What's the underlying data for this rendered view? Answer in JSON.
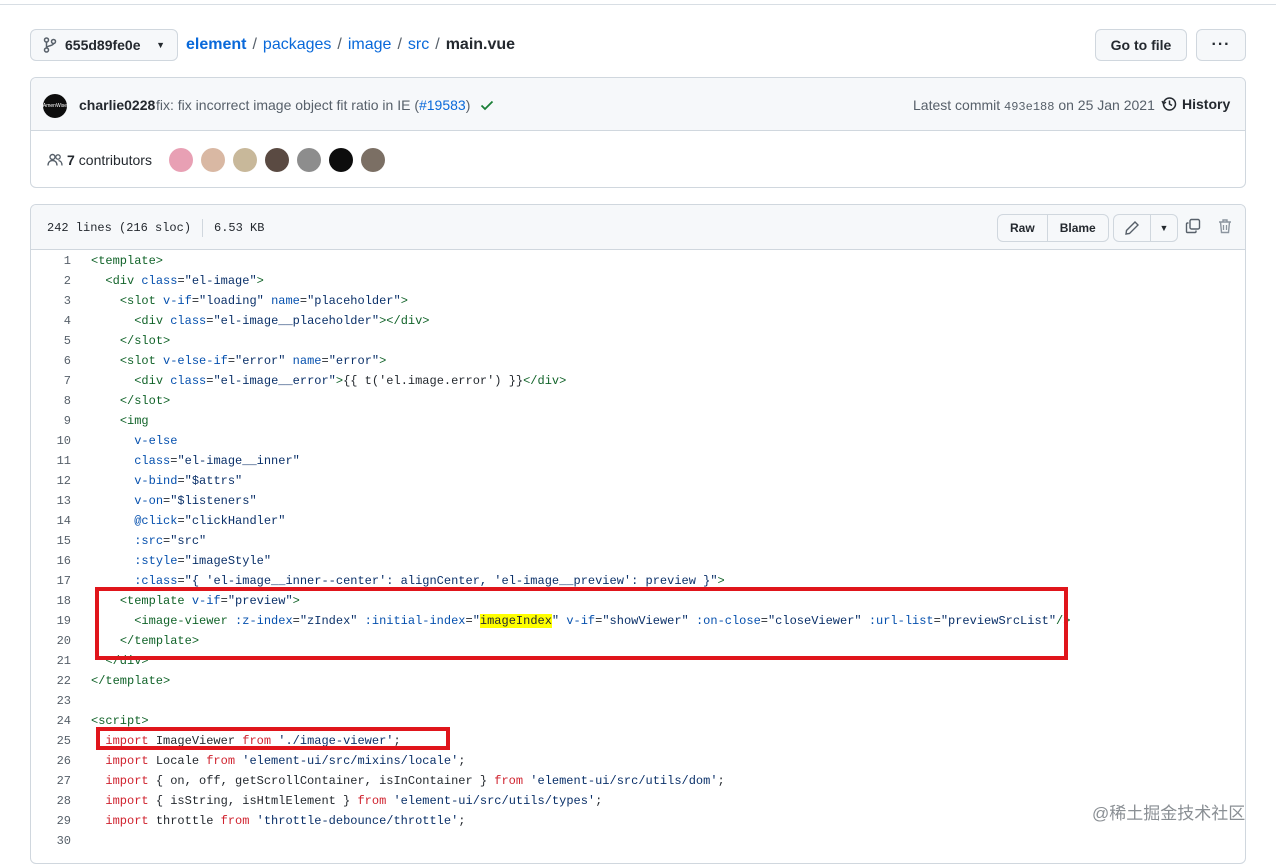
{
  "repo": {
    "branch": "655d89fe0e",
    "crumbs": [
      "element",
      "packages",
      "image",
      "src"
    ],
    "current_file": "main.vue",
    "goto_label": "Go to file",
    "more_label": "···"
  },
  "commit": {
    "author": "charlie0228",
    "avatar_text": "AmenWise",
    "message": "fix: fix incorrect image object fit ratio in IE (",
    "pr": "#19583",
    "message_tail": ")",
    "latest_label": "Latest commit",
    "sha": "493e188",
    "date": "on 25 Jan 2021",
    "history_label": "History",
    "contributors_count": "7",
    "contributors_label": "contributors",
    "contributor_colors": [
      "#e8a0b4",
      "#d9b8a3",
      "#c8b89a",
      "#5a4a42",
      "#8d8d8d",
      "#0d0d0d",
      "#7b6f64"
    ]
  },
  "file": {
    "lines_info": "242 lines (216 sloc)",
    "size": "6.53 KB",
    "raw_label": "Raw",
    "blame_label": "Blame"
  },
  "code_lines": [
    {
      "n": "1",
      "parts": [
        [
          "t",
          "<template>"
        ]
      ]
    },
    {
      "n": "2",
      "parts": [
        [
          "",
          "  "
        ],
        [
          "t",
          "<div"
        ],
        [
          "",
          " "
        ],
        [
          "a",
          "class"
        ],
        [
          "",
          "="
        ],
        [
          "s",
          "\"el-image\""
        ],
        [
          "t",
          ">"
        ]
      ]
    },
    {
      "n": "3",
      "parts": [
        [
          "",
          "    "
        ],
        [
          "t",
          "<slot"
        ],
        [
          "",
          " "
        ],
        [
          "a",
          "v-if"
        ],
        [
          "",
          "="
        ],
        [
          "s",
          "\"loading\""
        ],
        [
          "",
          " "
        ],
        [
          "a",
          "name"
        ],
        [
          "",
          "="
        ],
        [
          "s",
          "\"placeholder\""
        ],
        [
          "t",
          ">"
        ]
      ]
    },
    {
      "n": "4",
      "parts": [
        [
          "",
          "      "
        ],
        [
          "t",
          "<div"
        ],
        [
          "",
          " "
        ],
        [
          "a",
          "class"
        ],
        [
          "",
          "="
        ],
        [
          "s",
          "\"el-image__placeholder\""
        ],
        [
          "t",
          "></div>"
        ]
      ]
    },
    {
      "n": "5",
      "parts": [
        [
          "",
          "    "
        ],
        [
          "t",
          "</slot>"
        ]
      ]
    },
    {
      "n": "6",
      "parts": [
        [
          "",
          "    "
        ],
        [
          "t",
          "<slot"
        ],
        [
          "",
          " "
        ],
        [
          "a",
          "v-else-if"
        ],
        [
          "",
          "="
        ],
        [
          "s",
          "\"error\""
        ],
        [
          "",
          " "
        ],
        [
          "a",
          "name"
        ],
        [
          "",
          "="
        ],
        [
          "s",
          "\"error\""
        ],
        [
          "t",
          ">"
        ]
      ]
    },
    {
      "n": "7",
      "parts": [
        [
          "",
          "      "
        ],
        [
          "t",
          "<div"
        ],
        [
          "",
          " "
        ],
        [
          "a",
          "class"
        ],
        [
          "",
          "="
        ],
        [
          "s",
          "\"el-image__error\""
        ],
        [
          "t",
          ">"
        ],
        [
          "",
          "{{ t('el.image.error') }}"
        ],
        [
          "t",
          "</div>"
        ]
      ]
    },
    {
      "n": "8",
      "parts": [
        [
          "",
          "    "
        ],
        [
          "t",
          "</slot>"
        ]
      ]
    },
    {
      "n": "9",
      "parts": [
        [
          "",
          "    "
        ],
        [
          "t",
          "<img"
        ]
      ]
    },
    {
      "n": "10",
      "parts": [
        [
          "",
          "      "
        ],
        [
          "a",
          "v-else"
        ]
      ]
    },
    {
      "n": "11",
      "parts": [
        [
          "",
          "      "
        ],
        [
          "a",
          "class"
        ],
        [
          "",
          "="
        ],
        [
          "s",
          "\"el-image__inner\""
        ]
      ]
    },
    {
      "n": "12",
      "parts": [
        [
          "",
          "      "
        ],
        [
          "a",
          "v-bind"
        ],
        [
          "",
          "="
        ],
        [
          "s",
          "\"$attrs\""
        ]
      ]
    },
    {
      "n": "13",
      "parts": [
        [
          "",
          "      "
        ],
        [
          "a",
          "v-on"
        ],
        [
          "",
          "="
        ],
        [
          "s",
          "\"$listeners\""
        ]
      ]
    },
    {
      "n": "14",
      "parts": [
        [
          "",
          "      "
        ],
        [
          "a",
          "@click"
        ],
        [
          "",
          "="
        ],
        [
          "s",
          "\"clickHandler\""
        ]
      ]
    },
    {
      "n": "15",
      "parts": [
        [
          "",
          "      "
        ],
        [
          "a",
          ":src"
        ],
        [
          "",
          "="
        ],
        [
          "s",
          "\"src\""
        ]
      ]
    },
    {
      "n": "16",
      "parts": [
        [
          "",
          "      "
        ],
        [
          "a",
          ":style"
        ],
        [
          "",
          "="
        ],
        [
          "s",
          "\"imageStyle\""
        ]
      ]
    },
    {
      "n": "17",
      "parts": [
        [
          "",
          "      "
        ],
        [
          "a",
          ":class"
        ],
        [
          "",
          "="
        ],
        [
          "s",
          "\"{ 'el-image__inner--center': alignCenter, 'el-image__preview': preview }\""
        ],
        [
          "t",
          ">"
        ]
      ]
    },
    {
      "n": "18",
      "parts": [
        [
          "",
          "    "
        ],
        [
          "t",
          "<template"
        ],
        [
          "",
          " "
        ],
        [
          "a",
          "v-if"
        ],
        [
          "",
          "="
        ],
        [
          "s",
          "\"preview\""
        ],
        [
          "t",
          ">"
        ]
      ]
    },
    {
      "n": "19",
      "parts": [
        [
          "",
          "      "
        ],
        [
          "t",
          "<image-viewer"
        ],
        [
          "",
          " "
        ],
        [
          "a",
          ":z-index"
        ],
        [
          "",
          "="
        ],
        [
          "s",
          "\"zIndex\""
        ],
        [
          "",
          " "
        ],
        [
          "a",
          ":initial-index"
        ],
        [
          "",
          "="
        ],
        [
          "s",
          "\""
        ],
        [
          "m",
          "imageIndex"
        ],
        [
          "s",
          "\""
        ],
        [
          "",
          " "
        ],
        [
          "a",
          "v-if"
        ],
        [
          "",
          "="
        ],
        [
          "s",
          "\"showViewer\""
        ],
        [
          "",
          " "
        ],
        [
          "a",
          ":on-close"
        ],
        [
          "",
          "="
        ],
        [
          "s",
          "\"closeViewer\""
        ],
        [
          "",
          " "
        ],
        [
          "a",
          ":url-list"
        ],
        [
          "",
          "="
        ],
        [
          "s",
          "\"previewSrcList\""
        ],
        [
          "t",
          "/>"
        ]
      ]
    },
    {
      "n": "20",
      "parts": [
        [
          "",
          "    "
        ],
        [
          "t",
          "</template>"
        ]
      ]
    },
    {
      "n": "21",
      "parts": [
        [
          "",
          "  "
        ],
        [
          "t",
          "</div>"
        ]
      ]
    },
    {
      "n": "22",
      "parts": [
        [
          "t",
          "</template>"
        ]
      ]
    },
    {
      "n": "23",
      "parts": [
        [
          "",
          ""
        ]
      ]
    },
    {
      "n": "24",
      "parts": [
        [
          "t",
          "<script>"
        ]
      ]
    },
    {
      "n": "25",
      "parts": [
        [
          "",
          "  "
        ],
        [
          "k",
          "import"
        ],
        [
          "",
          " ImageViewer "
        ],
        [
          "k",
          "from"
        ],
        [
          "",
          " "
        ],
        [
          "s",
          "'./image-viewer'"
        ],
        [
          "",
          ";"
        ]
      ]
    },
    {
      "n": "26",
      "parts": [
        [
          "",
          "  "
        ],
        [
          "k",
          "import"
        ],
        [
          "",
          " Locale "
        ],
        [
          "k",
          "from"
        ],
        [
          "",
          " "
        ],
        [
          "s",
          "'element-ui/src/mixins/locale'"
        ],
        [
          "",
          ";"
        ]
      ]
    },
    {
      "n": "27",
      "parts": [
        [
          "",
          "  "
        ],
        [
          "k",
          "import"
        ],
        [
          "",
          " { on, off, getScrollContainer, isInContainer } "
        ],
        [
          "k",
          "from"
        ],
        [
          "",
          " "
        ],
        [
          "s",
          "'element-ui/src/utils/dom'"
        ],
        [
          "",
          ";"
        ]
      ]
    },
    {
      "n": "28",
      "parts": [
        [
          "",
          "  "
        ],
        [
          "k",
          "import"
        ],
        [
          "",
          " { isString, isHtmlElement } "
        ],
        [
          "k",
          "from"
        ],
        [
          "",
          " "
        ],
        [
          "s",
          "'element-ui/src/utils/types'"
        ],
        [
          "",
          ";"
        ]
      ]
    },
    {
      "n": "29",
      "parts": [
        [
          "",
          "  "
        ],
        [
          "k",
          "import"
        ],
        [
          "",
          " throttle "
        ],
        [
          "k",
          "from"
        ],
        [
          "",
          " "
        ],
        [
          "s",
          "'throttle-debounce/throttle'"
        ],
        [
          "",
          ";"
        ]
      ]
    },
    {
      "n": "30",
      "parts": [
        [
          "",
          ""
        ]
      ]
    }
  ],
  "watermark": "@稀土掘金技术社区",
  "colors": {
    "link": "#0969da",
    "annotation_red": "#e0151b",
    "success": "#1a7f37"
  }
}
